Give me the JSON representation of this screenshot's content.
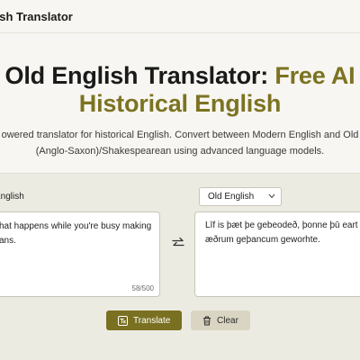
{
  "header": {
    "brand": "lish Translator"
  },
  "hero": {
    "title_line1": "Old English Translator:",
    "title_accent1": "Free AI",
    "title_accent2": "Historical English"
  },
  "subtitle": {
    "line1": "owered translator for historical English. Convert between Modern English and Old",
    "line2": "(Anglo-Saxon)/Shakespearean using advanced language models."
  },
  "translator": {
    "source_language": "English",
    "target_language": "Old English",
    "input_line1": "hat happens while you're busy making",
    "input_line2": "ans.",
    "char_count": "58/500",
    "output_line1": "Līf is þæt þe gebeodeð, þonne þū eart b",
    "output_line2": "æðrum geþancum geworhte."
  },
  "actions": {
    "translate_label": "Translate",
    "clear_label": "Clear"
  },
  "icons": {
    "swap": "swap-arrows-icon",
    "translate": "translate-icon",
    "clear": "trash-icon",
    "select": "chevron-down-icon"
  },
  "colors": {
    "accent": "#7c7322",
    "button_primary": "#7a7021",
    "button_secondary": "#d9d5c2",
    "panel_bg": "#ecebe2"
  }
}
